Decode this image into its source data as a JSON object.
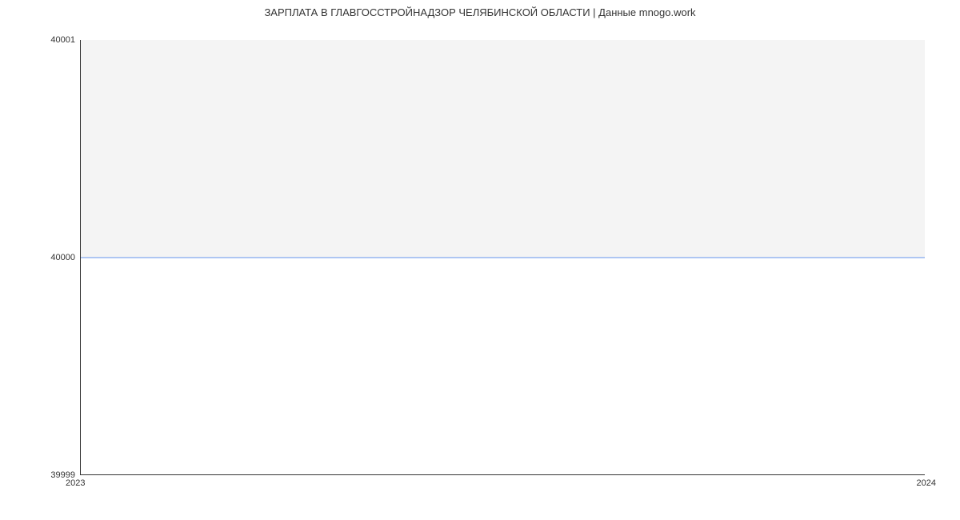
{
  "chart_data": {
    "type": "line",
    "title": "ЗАРПЛАТА В ГЛАВГОССТРОЙНАДЗОР ЧЕЛЯБИНСКОЙ ОБЛАСТИ | Данные mnogo.work",
    "x": [
      2023,
      2024
    ],
    "y": [
      40000,
      40000
    ],
    "xlim": [
      2023,
      2024
    ],
    "ylim": [
      39999,
      40001
    ],
    "y_ticks": [
      39999,
      40000,
      40001
    ],
    "x_ticks": [
      2023,
      2024
    ],
    "xlabel": "",
    "ylabel": ""
  },
  "title": "ЗАРПЛАТА В ГЛАВГОССТРОЙНАДЗОР ЧЕЛЯБИНСКОЙ ОБЛАСТИ | Данные mnogo.work",
  "y_labels": {
    "top": "40001",
    "mid": "40000",
    "bot": "39999"
  },
  "x_labels": {
    "left": "2023",
    "right": "2024"
  }
}
